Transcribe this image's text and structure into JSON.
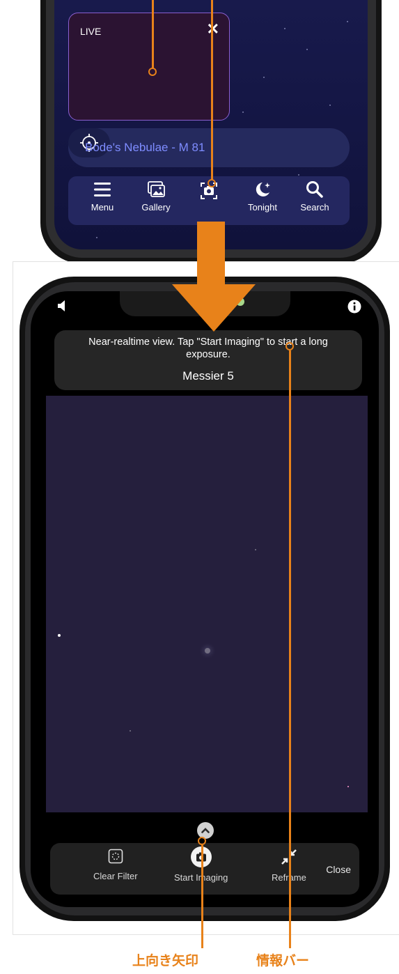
{
  "top_screen": {
    "live_label": "LIVE",
    "live_close": "✕",
    "target_name": "Bode's Nebulae - M 81",
    "tabs": [
      {
        "label": "Menu",
        "icon": "menu-icon"
      },
      {
        "label": "Gallery",
        "icon": "gallery-icon"
      },
      {
        "label": "",
        "icon": "camera-icon"
      },
      {
        "label": "Tonight",
        "icon": "moon-icon"
      },
      {
        "label": "Search",
        "icon": "search-icon"
      }
    ]
  },
  "bottom_screen": {
    "info_text": "Near-realtime view. Tap \"Start Imaging\" to start a long exposure.",
    "target_name": "Messier 5",
    "toolbar": {
      "clear_filter": "Clear Filter",
      "start_imaging": "Start Imaging",
      "reframe": "Reframe",
      "close": "Close"
    }
  },
  "annotations": {
    "up_arrow": "上向き矢印",
    "info_bar": "情報バー"
  },
  "colors": {
    "annotation": "#e8821a",
    "target_text": "#7e8cff",
    "live_border": "#8a5fd0"
  }
}
